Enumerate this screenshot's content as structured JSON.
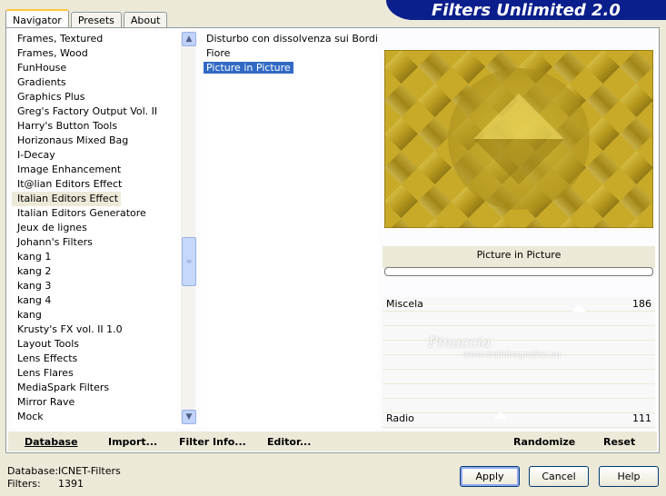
{
  "tabs": [
    "Navigator",
    "Presets",
    "About"
  ],
  "brand": "Filters Unlimited 2.0",
  "categories": [
    "Frames, Textured",
    "Frames, Wood",
    "FunHouse",
    "Gradients",
    "Graphics Plus",
    "Greg's Factory Output Vol. II",
    "Harry's Button Tools",
    "Horizonaus Mixed Bag",
    "I-Decay",
    "Image Enhancement",
    "It@lian Editors Effect",
    "Italian Editors Effect",
    "Italian Editors Generatore",
    "Jeux de lignes",
    "Johann's Filters",
    "kang 1",
    "kang 2",
    "kang 3",
    "kang 4",
    "kang",
    "Krusty's FX vol. II 1.0",
    "Layout Tools",
    "Lens Effects",
    "Lens Flares",
    "MediaSpark Filters",
    "Mirror Rave",
    "Mock"
  ],
  "selected_category": "Italian Editors Effect",
  "filters": [
    "Disturbo con dissolvenza sui Bordi",
    "Fiore",
    "Picture in Picture"
  ],
  "selected_filter": "Picture in Picture",
  "preview_title": "Picture in Picture",
  "progress": 0,
  "params": {
    "p1_label": "Miscela",
    "p1_value": "186",
    "p2_label": "Radio",
    "p2_value": "111"
  },
  "watermark": {
    "title": "Pinuccia",
    "url": "www.maildirsgrafica.eu"
  },
  "bottom": {
    "database": "Database",
    "import": "Import...",
    "filter_info": "Filter Info...",
    "editor": "Editor...",
    "randomize": "Randomize",
    "reset": "Reset"
  },
  "status": {
    "db_label": "Database:",
    "db_value": "ICNET-Filters",
    "filters_label": "Filters:",
    "filters_value": "1391"
  },
  "buttons": {
    "apply": "Apply",
    "cancel": "Cancel",
    "help": "Help"
  },
  "colors": {
    "window_bg": "#ece9d8",
    "brand_bg": "#0a1e8c",
    "selection": "#316ac5",
    "gold": "#c8aa28"
  }
}
